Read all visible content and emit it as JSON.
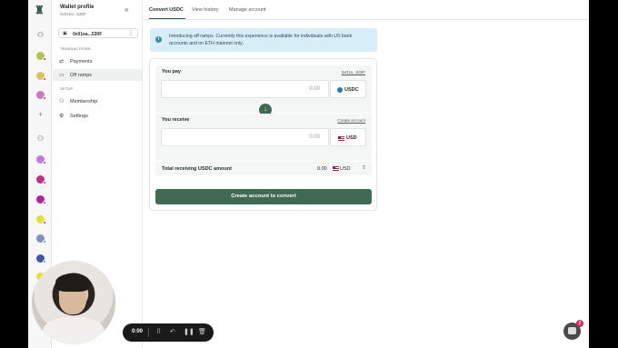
{
  "sidebar": {
    "title": "Wallet profile",
    "address": "0x01ea...530F",
    "wallet_pill": "0x01ea...530F",
    "section_transactions": "TRANSACTIONS",
    "section_setup": "SETUP",
    "items": [
      {
        "label": "Payments",
        "icon": "payments-icon"
      },
      {
        "label": "Off ramps",
        "icon": "card-icon"
      },
      {
        "label": "Membership",
        "icon": "membership-icon"
      },
      {
        "label": "Settings",
        "icon": "gear-icon"
      }
    ]
  },
  "tabs": [
    "Convert USDC",
    "View history",
    "Manage account"
  ],
  "banner": {
    "text": "Introducing off ramps. Currently this experience is available for individuals with US bank accounts and on ETH mainnet only."
  },
  "pay": {
    "label": "You pay",
    "address_link": "0x01a...530F",
    "amount": "0.00",
    "currency": "USDC"
  },
  "receive": {
    "label": "You receive",
    "link": "Create account",
    "amount": "0.00",
    "currency": "USD"
  },
  "total": {
    "label": "Total receiving USDC amount",
    "amount": "0.00",
    "currency": "USD"
  },
  "cta": "Create account to convert",
  "recorder": {
    "time": "0:00"
  },
  "chat": {
    "badge": "2"
  },
  "colors": {
    "accent": "#3f6b55",
    "banner": "#d7eef8",
    "badge": "#e0245e"
  }
}
